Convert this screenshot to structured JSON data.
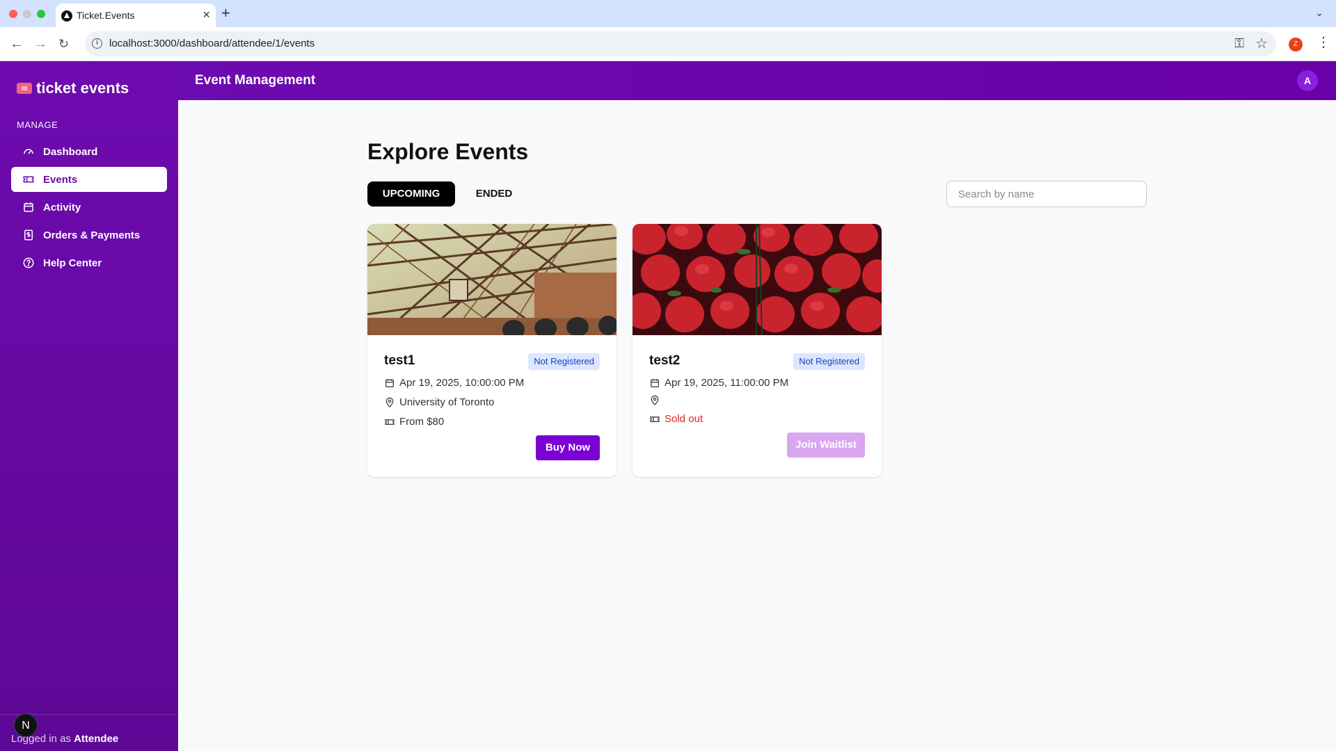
{
  "browser": {
    "tab_title": "Ticket.Events",
    "url": "localhost:3000/dashboard/attendee/1/events",
    "profile_initial": "Z"
  },
  "sidebar": {
    "brand": "ticket events",
    "section_label": "MANAGE",
    "items": [
      {
        "label": "Dashboard",
        "icon": "gauge-icon"
      },
      {
        "label": "Events",
        "icon": "ticket-icon",
        "active": true
      },
      {
        "label": "Activity",
        "icon": "calendar-icon"
      },
      {
        "label": "Orders & Payments",
        "icon": "receipt-icon"
      },
      {
        "label": "Help Center",
        "icon": "help-icon"
      }
    ],
    "footer": {
      "prefix": "Logged in as",
      "role": "Attendee"
    },
    "overlay_badge": "N"
  },
  "topbar": {
    "title": "Event Management",
    "avatar_initial": "A"
  },
  "main": {
    "title": "Explore Events",
    "tabs": [
      {
        "label": "UPCOMING",
        "active": true
      },
      {
        "label": "ENDED"
      }
    ],
    "search_placeholder": "Search by name",
    "events": [
      {
        "title": "test1",
        "badge": "Not Registered",
        "date": "Apr 19, 2025, 10:00:00 PM",
        "location": "University of Toronto",
        "price": "From $80",
        "action": "Buy Now",
        "image": "steel-structure-photo"
      },
      {
        "title": "test2",
        "badge": "Not Registered",
        "date": "Apr 19, 2025, 11:00:00 PM",
        "location": "",
        "price": "Sold out",
        "action": "Join Waitlist",
        "image": "strawberries-photo"
      }
    ]
  },
  "colors": {
    "brand_purple": "#6e0bb0",
    "accent_button": "#7a00d4",
    "badge_bg": "#dbe7ff",
    "sold_out": "#e0241c"
  }
}
